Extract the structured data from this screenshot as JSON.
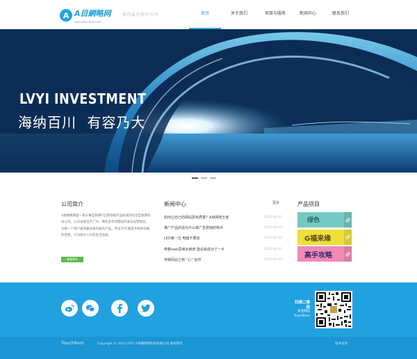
{
  "header": {
    "logo_badge": "A",
    "logo_text": "A目網略网",
    "logo_sub": "www.aimuweb.com",
    "slogan": "做你最信赖的伙伴",
    "nav": [
      "首页",
      "关于我们",
      "项目与服务",
      "新闻中心",
      "联系我们"
    ]
  },
  "banner": {
    "title": "LVYI INVESTMENT",
    "subtitle": "海纳百川 有容乃大"
  },
  "about": {
    "title": "公司简介",
    "text": "A目網略网是一家从事互联网IT应用领域产品研发的综合互联网科技公司。公司总部位于广州，拥有多年的网站开发与运营经验，为每一个用户提供最优质的服务产品，专注于PC端及手机移动端的完善，只为提升人们的生活品质。",
    "button": "查看更多"
  },
  "news": {
    "title": "新闻中心",
    "more": "更多",
    "items": [
      {
        "title": "如何让自己的网站更有质量？A目网络王者",
        "date": "2015-04-03"
      },
      {
        "title": "推广产品的话为什么做广告费用的特点",
        "date": "2015-04-03"
      },
      {
        "title": "LED第一位 电脑不要钱",
        "date": "2015-04-03"
      },
      {
        "title": "带着web思维去维修 建设就成功了一半",
        "date": "2015-04-03"
      },
      {
        "title": "传媒而此之特 “心” 创作",
        "date": "2015-04-03"
      }
    ]
  },
  "products": {
    "title": "产品项目",
    "items": [
      {
        "label": "绿色",
        "color": "#74c9c3"
      },
      {
        "label": "G福来缘",
        "color": "#ece03a"
      },
      {
        "label": "高手攻略",
        "color": "#f089b6"
      }
    ]
  },
  "footer": {
    "social": [
      "weibo-icon",
      "weixin-icon",
      "facebook-icon",
      "twitter-icon"
    ],
    "qr_title": "扫描二维码",
    "qr_lines": [
      "关注微信",
      "TouchRom"
    ],
    "brand": "TouchRom",
    "copyright": "Copyright © 2002-2015 A目網略网科技有限公司 版权所有",
    "tech": "技术支持"
  },
  "colors": {
    "accent": "#22a1e0",
    "footer_dark": "#1b95d3",
    "button_green": "#5fb84c"
  }
}
